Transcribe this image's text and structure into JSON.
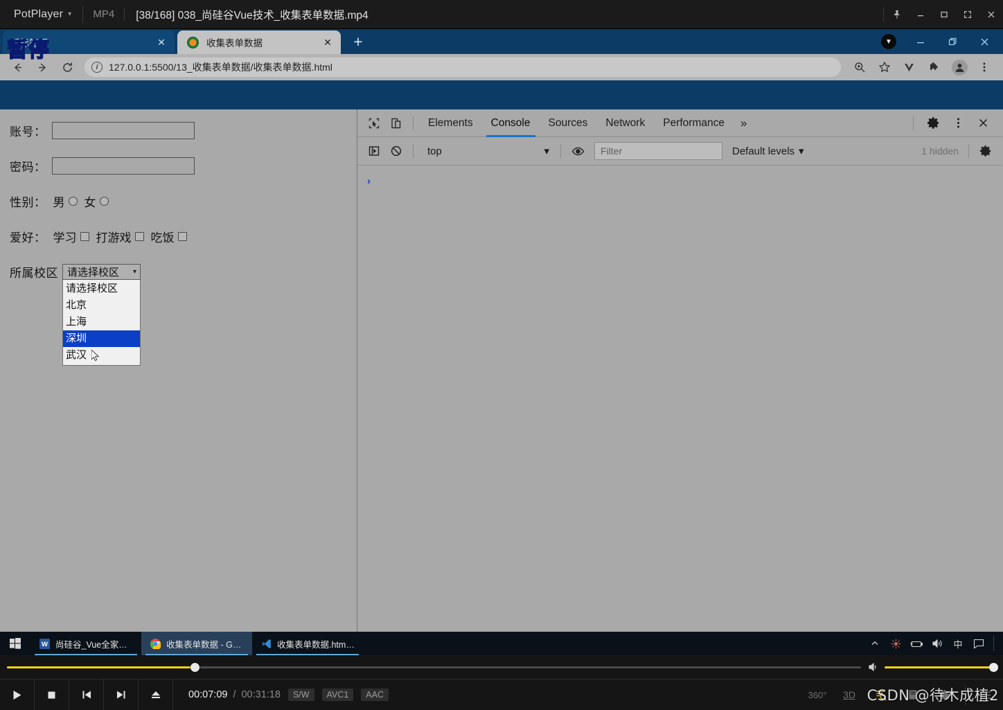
{
  "player": {
    "app_name": "PotPlayer",
    "format_badge": "MP4",
    "media_title": "[38/168] 038_尚硅谷Vue技术_收集表单数据.mp4",
    "window_buttons": [
      "pin-icon",
      "minimize-icon",
      "maximize-icon",
      "fullscreen-icon",
      "close-icon"
    ],
    "paused_overlay": "暂停",
    "time_current": "00:07:09",
    "time_separator": "/",
    "time_total": "00:31:18",
    "codecs": [
      "S/W",
      "AVC1",
      "AAC"
    ],
    "seek_percent": 22,
    "volume_percent": 100,
    "controls": [
      "play-icon",
      "stop-icon",
      "previous-icon",
      "next-icon",
      "eject-icon"
    ],
    "right_controls": [
      "360-button",
      "3d-button",
      "search-icon",
      "playlist-icon",
      "settings-icon",
      "menu-icon"
    ],
    "label_360": "360°",
    "label_3d": "3D",
    "accent_color": "#f5d512"
  },
  "watermark": "CSDN @待木成植2",
  "browser": {
    "tabs": [
      {
        "title": "新标签页",
        "active": false,
        "favicon": "none"
      },
      {
        "title": "收集表单数据",
        "active": true,
        "favicon": "live-server-icon"
      }
    ],
    "new_tab_label": "+",
    "close_label": "✕",
    "window_controls": [
      "downloads-icon",
      "minimize-icon",
      "restore-icon",
      "close-icon"
    ],
    "toolbar": {
      "back_icon": "back-arrow-icon",
      "forward_icon": "forward-arrow-icon",
      "reload_icon": "reload-icon",
      "site_info_icon": "info-circle-icon",
      "url": "127.0.0.1:5500/13_收集表单数据/收集表单数据.html",
      "right_icons": [
        "zoom-icon",
        "bookmark-star-icon",
        "vue-devtools-icon",
        "extensions-puzzle-icon",
        "profile-avatar-icon",
        "chrome-menu-icon"
      ]
    }
  },
  "page_form": {
    "fields": [
      {
        "label": "账号：",
        "type": "text",
        "value": ""
      },
      {
        "label": "密码：",
        "type": "text",
        "value": ""
      }
    ],
    "gender": {
      "label": "性别：",
      "options": [
        {
          "text": "男",
          "checked": false
        },
        {
          "text": "女",
          "checked": false
        }
      ]
    },
    "hobby": {
      "label": "爱好：",
      "options": [
        {
          "text": "学习",
          "checked": false
        },
        {
          "text": "打游戏",
          "checked": false
        },
        {
          "text": "吃饭",
          "checked": false
        }
      ]
    },
    "campus": {
      "label": "所属校区",
      "selected": "请选择校区",
      "open": true,
      "caret": "▾",
      "options": [
        {
          "text": "请选择校区",
          "highlighted": false
        },
        {
          "text": "北京",
          "highlighted": false
        },
        {
          "text": "上海",
          "highlighted": false
        },
        {
          "text": "深圳",
          "highlighted": true
        },
        {
          "text": "武汉",
          "highlighted": false
        }
      ],
      "highlight_color": "#0b3fc6"
    }
  },
  "devtools": {
    "left_icons": [
      "inspect-element-icon",
      "device-toolbar-icon"
    ],
    "tabs": [
      {
        "label": "Elements",
        "active": false
      },
      {
        "label": "Console",
        "active": true
      },
      {
        "label": "Sources",
        "active": false
      },
      {
        "label": "Network",
        "active": false
      },
      {
        "label": "Performance",
        "active": false
      }
    ],
    "more_tabs_label": "»",
    "right_icons": [
      "settings-gear-icon",
      "devtools-menu-icon",
      "devtools-close-icon"
    ],
    "console": {
      "sidebar_toggle_icon": "console-sidebar-icon",
      "clear_icon": "clear-console-icon",
      "context": "top",
      "context_caret": "▾",
      "eye_icon": "live-expression-icon",
      "filter_placeholder": "Filter",
      "levels_label": "Default levels",
      "levels_caret": "▾",
      "hidden_label": "1 hidden",
      "settings_icon": "console-settings-icon",
      "prompt": "›"
    },
    "active_tab_underline_color": "#1a73c8"
  },
  "taskbar": {
    "start_icon": "windows-start-icon",
    "items": [
      {
        "label": "尚硅谷_Vue全家桶.d...",
        "icon": "word-icon",
        "active": false
      },
      {
        "label": "收集表单数据 - Goo...",
        "icon": "chrome-icon",
        "active": true
      },
      {
        "label": "收集表单数据.html - ...",
        "icon": "vscode-icon",
        "active": false
      }
    ],
    "tray": [
      "chevron-up-icon",
      "360-security-icon",
      "battery-icon",
      "volume-icon",
      "ime-chinese-icon",
      "action-center-icon"
    ],
    "ime_label": "中"
  }
}
